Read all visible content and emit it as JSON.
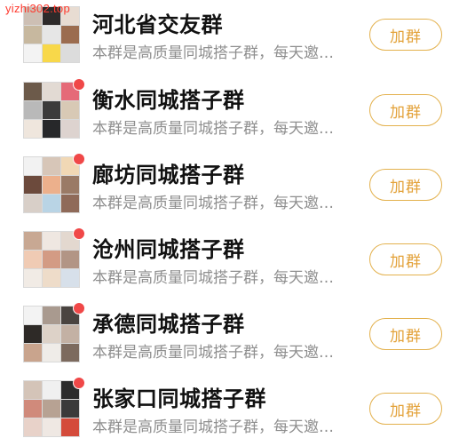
{
  "watermark": "yizhi302.top",
  "groups": [
    {
      "name": "河北省交友群",
      "description": "本群是高质量同城搭子群，每天邀…",
      "button": "加群",
      "has_dot": false,
      "tiles": [
        "#cdbfb4",
        "#2d2a2a",
        "#e8dcd2",
        "#c7b89f",
        "#e6e6e6",
        "#9b6c4f",
        "#f3f3f3",
        "#f8d84a",
        "#dcdcdc"
      ]
    },
    {
      "name": "衡水同城搭子群",
      "description": "本群是高质量同城搭子群，每天邀…",
      "button": "加群",
      "has_dot": true,
      "tiles": [
        "#6c5a4a",
        "#e2dad3",
        "#e56a78",
        "#b9b9b9",
        "#3b3b3b",
        "#d8c9b5",
        "#efe6dd",
        "#27282a",
        "#ddd3cf"
      ]
    },
    {
      "name": "廊坊同城搭子群",
      "description": "本群是高质量同城搭子群，每天邀…",
      "button": "加群",
      "has_dot": true,
      "tiles": [
        "#f2f2f2",
        "#d7c6b8",
        "#f1d8b5",
        "#6c4a3c",
        "#ecb08c",
        "#9a7a66",
        "#d8cfc8",
        "#b9d4e5",
        "#8f6a59"
      ]
    },
    {
      "name": "沧州同城搭子群",
      "description": "本群是高质量同城搭子群，每天邀…",
      "button": "加群",
      "has_dot": true,
      "tiles": [
        "#c8a893",
        "#efe7e1",
        "#e3d8cf",
        "#f0cbb4",
        "#d39b84",
        "#b29585",
        "#f1ebe5",
        "#eedcc9",
        "#d7e0ea"
      ]
    },
    {
      "name": "承德同城搭子群",
      "description": "本群是高质量同城搭子群，每天邀…",
      "button": "加群",
      "has_dot": true,
      "tiles": [
        "#f3f3f3",
        "#a99a8f",
        "#4a4440",
        "#2e2a27",
        "#ddd2c8",
        "#c3b1a4",
        "#c9a48d",
        "#efece8",
        "#7c6a5e"
      ]
    },
    {
      "name": "张家口同城搭子群",
      "description": "本群是高质量同城搭子群，每天邀…",
      "button": "加群",
      "has_dot": true,
      "tiles": [
        "#d4c4b8",
        "#f0f0f0",
        "#2c2c2c",
        "#d08a7b",
        "#b7a293",
        "#3a3a3a",
        "#e8d2c9",
        "#efe8e3",
        "#d44b3b"
      ]
    }
  ]
}
